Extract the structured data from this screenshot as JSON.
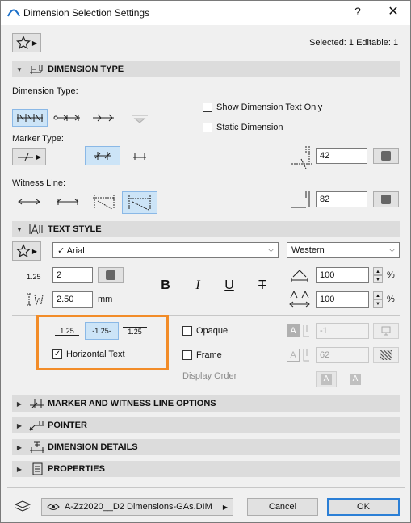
{
  "window": {
    "title": "Dimension Selection Settings",
    "help": "?",
    "close": "✕"
  },
  "header": {
    "selected_info": "Selected: 1 Editable: 1"
  },
  "sections": {
    "dimension_type": "DIMENSION TYPE",
    "text_style": "TEXT STYLE",
    "marker_witness": "MARKER AND WITNESS LINE OPTIONS",
    "pointer": "POINTER",
    "dimension_details": "DIMENSION DETAILS",
    "properties": "PROPERTIES"
  },
  "dimension_type": {
    "dimension_type_label": "Dimension Type:",
    "marker_type_label": "Marker Type:",
    "witness_line_label": "Witness Line:",
    "show_text_only": {
      "label": "Show Dimension Text Only",
      "checked": false
    },
    "static_dimension": {
      "label": "Static Dimension",
      "checked": false
    },
    "marker_size": "42",
    "witness_length": "82"
  },
  "text_style": {
    "font": "Arial",
    "font_check": "✓",
    "script": "Western",
    "text_size": "2",
    "text_size_icon": "1.25",
    "spacing": "2.50",
    "spacing_unit": "mm",
    "bold": "B",
    "italic": "I",
    "underline": "U",
    "strike": "T",
    "width_pct": "100",
    "spacing_pct": "100",
    "pct": "%",
    "position_samples": [
      "1.25",
      "-1.25-",
      "1.25"
    ],
    "horizontal_text": {
      "label": "Horizontal Text",
      "checked": true
    },
    "opaque": {
      "label": "Opaque",
      "checked": false
    },
    "frame": {
      "label": "Frame",
      "checked": false
    },
    "display_order": "Display Order",
    "opaque_value": "-1",
    "frame_value": "62",
    "letter_a": "A"
  },
  "footer": {
    "layer": "A-Zz2020__D2 Dimensions-GAs.DIM",
    "cancel": "Cancel",
    "ok": "OK"
  },
  "colors": {
    "accent": "#f28c28",
    "selected": "#cce4f7",
    "section": "#dcdcdc"
  }
}
